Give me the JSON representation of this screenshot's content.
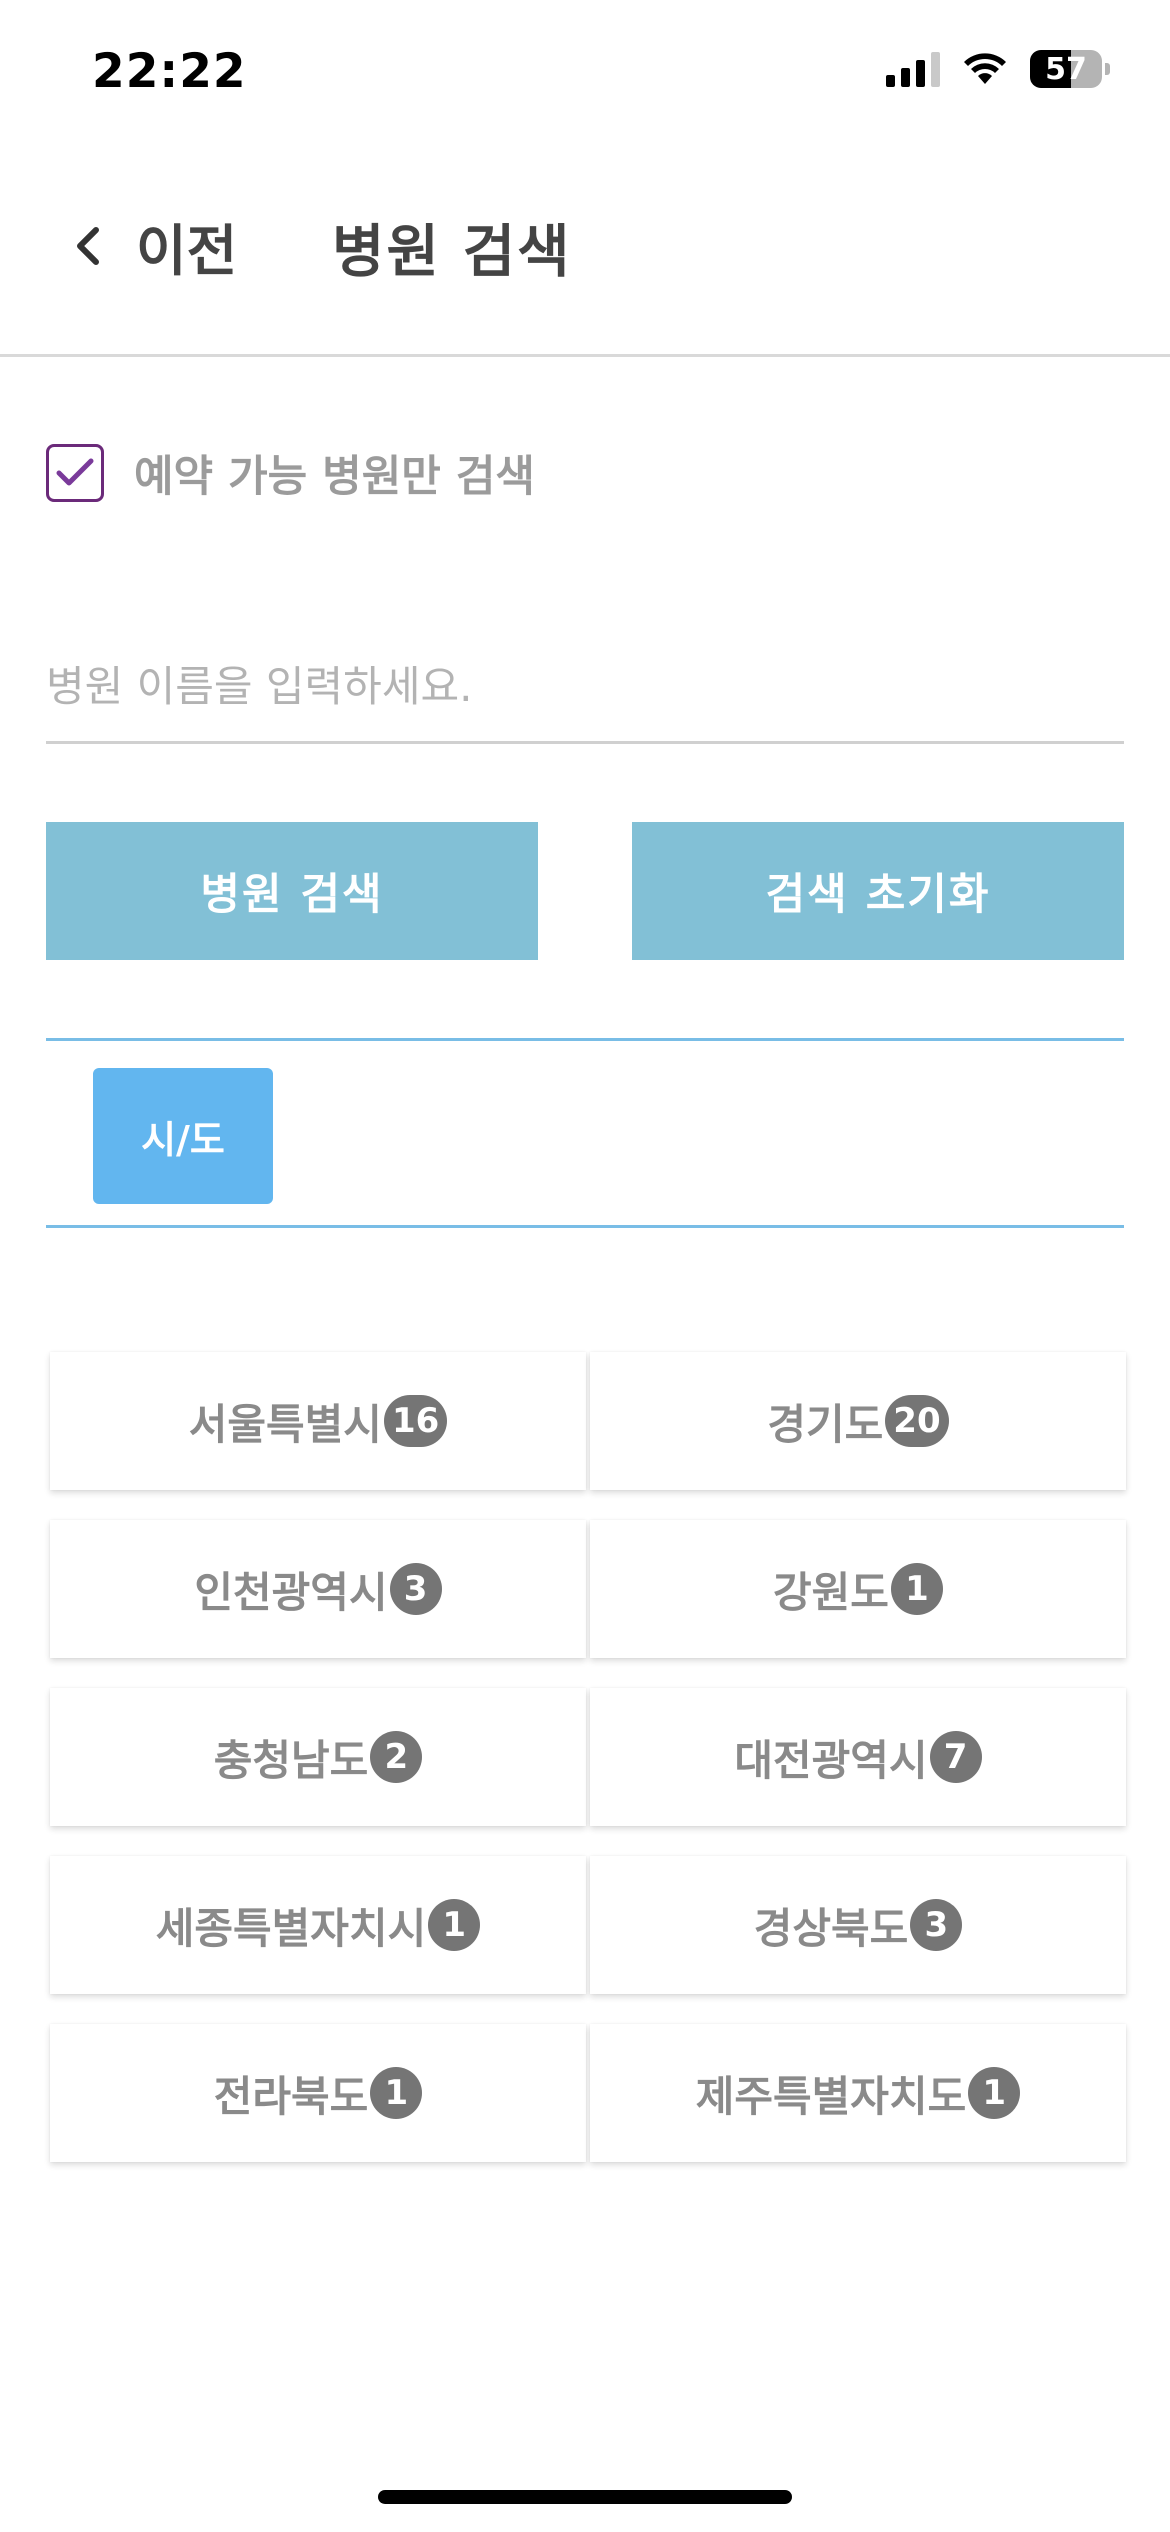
{
  "status_bar": {
    "time": "22:22",
    "battery_level": "57",
    "icons": [
      "signal-icon",
      "wifi-icon",
      "battery-icon"
    ]
  },
  "nav": {
    "back_label": "이전",
    "title": "병원 검색"
  },
  "filter": {
    "reservable_only_label": "예약 가능 병원만 검색",
    "reservable_only_checked": true
  },
  "search": {
    "placeholder": "병원 이름을 입력하세요.",
    "value": "",
    "search_button": "병원 검색",
    "reset_button": "검색 초기화"
  },
  "region_filter": {
    "chip_label": "시/도"
  },
  "regions": [
    {
      "name": "서울특별시",
      "count": "16"
    },
    {
      "name": "경기도",
      "count": "20"
    },
    {
      "name": "인천광역시",
      "count": "3"
    },
    {
      "name": "강원도",
      "count": "1"
    },
    {
      "name": "충청남도",
      "count": "2"
    },
    {
      "name": "대전광역시",
      "count": "7"
    },
    {
      "name": "세종특별자치시",
      "count": "1"
    },
    {
      "name": "경상북도",
      "count": "3"
    },
    {
      "name": "전라북도",
      "count": "1"
    },
    {
      "name": "제주특별자치도",
      "count": "1"
    }
  ],
  "colors": {
    "accent_button": "#82c0d6",
    "chip": "#62b6ef",
    "checkbox": "#6b2a7a",
    "badge": "#757575"
  }
}
